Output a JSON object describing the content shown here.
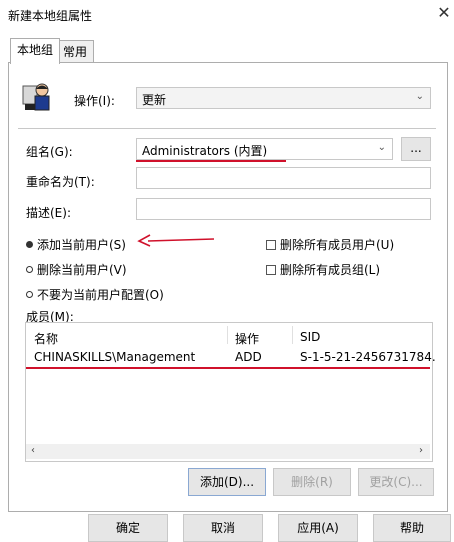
{
  "window": {
    "title": "新建本地组属性",
    "close_glyph": "✕"
  },
  "tabs": [
    {
      "label": "本地组"
    },
    {
      "label": "常用"
    }
  ],
  "action": {
    "label": "操作(I):",
    "value": "更新"
  },
  "group_name": {
    "label": "组名(G):",
    "value": "Administrators (内置)",
    "browse_label": "..."
  },
  "rename": {
    "label": "重命名为(T):",
    "value": ""
  },
  "description": {
    "label": "描述(E):",
    "value": ""
  },
  "options": {
    "add_current_user": "添加当前用户(S)",
    "remove_current_user": "删除当前用户(V)",
    "no_config_current_user": "不要为当前用户配置(O)",
    "delete_all_member_users": "删除所有成员用户(U)",
    "delete_all_member_groups": "删除所有成员组(L)",
    "selected": "add_current_user"
  },
  "members": {
    "label": "成员(M):",
    "columns": [
      "名称",
      "操作",
      "SID"
    ],
    "rows": [
      {
        "name": "CHINASKILLS\\Management",
        "action": "ADD",
        "sid": "S-1-5-21-2456731784."
      }
    ]
  },
  "member_buttons": {
    "add": "添加(D)...",
    "remove": "删除(R)",
    "change": "更改(C)..."
  },
  "dialog_buttons": {
    "ok": "确定",
    "cancel": "取消",
    "apply": "应用(A)",
    "help": "帮助"
  },
  "colors": {
    "annotation_red": "#d0112b"
  }
}
